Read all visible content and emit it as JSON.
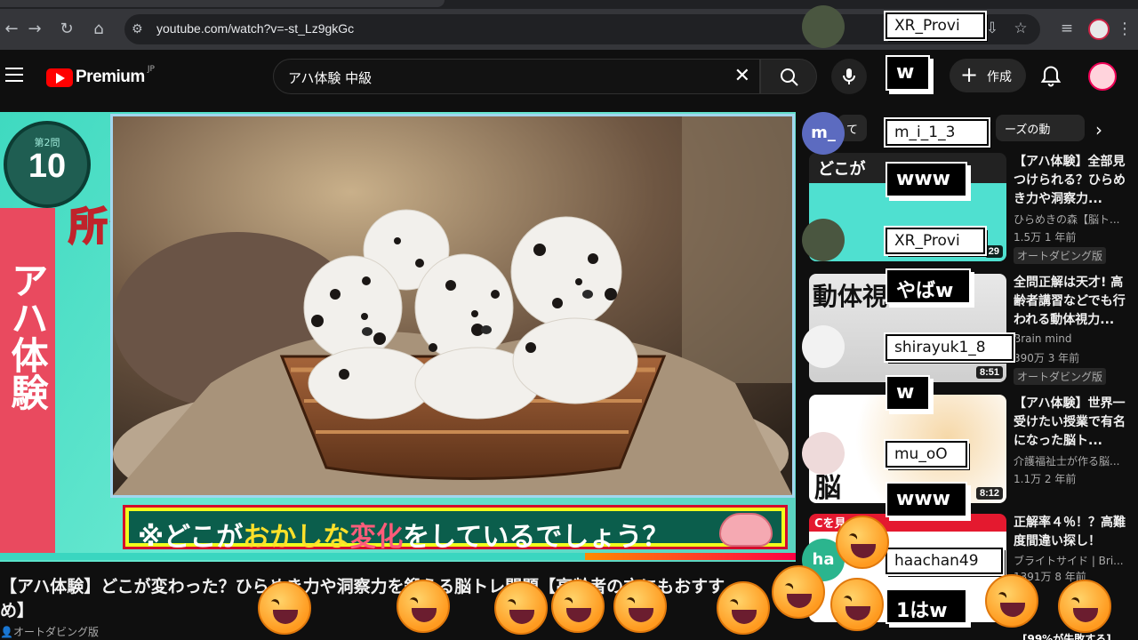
{
  "browser": {
    "url": "youtube.com/watch?v=-st_Lz9gkGc"
  },
  "header": {
    "logo_text": "Premium",
    "logo_region": "JP",
    "search_query": "アハ体験 中級",
    "create_label": "作成"
  },
  "video": {
    "question_label": "第2問",
    "timer_value": "10",
    "side_red_text": "アハ体験",
    "side_yellow_text": "全部で2カ所",
    "caption_prefix": "※どこが",
    "caption_hl1": "おかしな",
    "caption_hl2": "変化",
    "caption_suffix": "をしているでしょう？",
    "progress_played": 0.735,
    "title_line1": "【アハ体験】どこが変わった？ひらめき力や洞察力を鍛える脳トレ問題【高齢者の方にもおすす",
    "title_line2": "め】",
    "badge": "オートダビング版"
  },
  "sidebar": {
    "chips": [
      "て",
      "ーズの動"
    ],
    "recs": [
      {
        "title": "【アハ体験】全部見つけられる？ひらめき力や洞察力...",
        "channel": "ひらめきの森【脳ト...",
        "meta": "1.5万 1 年前",
        "badge": "オートダビング版",
        "duration": "29",
        "thumb_text": "どこが"
      },
      {
        "title": "全問正解は天才! 高齢者講習などでも行われる動体視力...",
        "channel": "Brain mind",
        "meta": "390万 3 年前",
        "badge": "オートダビング版",
        "duration": "8:51",
        "thumb_text": "動体視"
      },
      {
        "title": "【アハ体験】世界一受けたい授業で有名になった脳ト...",
        "channel": "介護福祉士が作る脳...",
        "meta": "1.1万 2 年前",
        "badge": "",
        "duration": "8:12",
        "thumb_text": "脳"
      },
      {
        "title": "正解率４％！？高難度間違い探し！",
        "channel": "ブライトサイド | Bri...",
        "meta": "1391万 8 年前",
        "badge": "",
        "duration": "",
        "thumb_text": "Cを見"
      }
    ],
    "last_title_partial": "[99%が失敗する]"
  },
  "chat": [
    {
      "name": "XR_Provi",
      "msg": "w"
    },
    {
      "name": "m_i_1_3",
      "msg": "www"
    },
    {
      "name": "XR_Provi",
      "msg": "やばw"
    },
    {
      "name": "shirayuk1_8",
      "msg": "w"
    },
    {
      "name": "mu_oO",
      "msg": "www"
    },
    {
      "name": "haachan49",
      "msg": "1はw"
    }
  ],
  "avatars": {
    "m": "m_",
    "ha": "ha"
  },
  "colors": {
    "accent": "#ff0000",
    "video_bg": "#3fd9c0",
    "side_red": "#e94a5f",
    "caption_bg": "#0b5e4c"
  }
}
